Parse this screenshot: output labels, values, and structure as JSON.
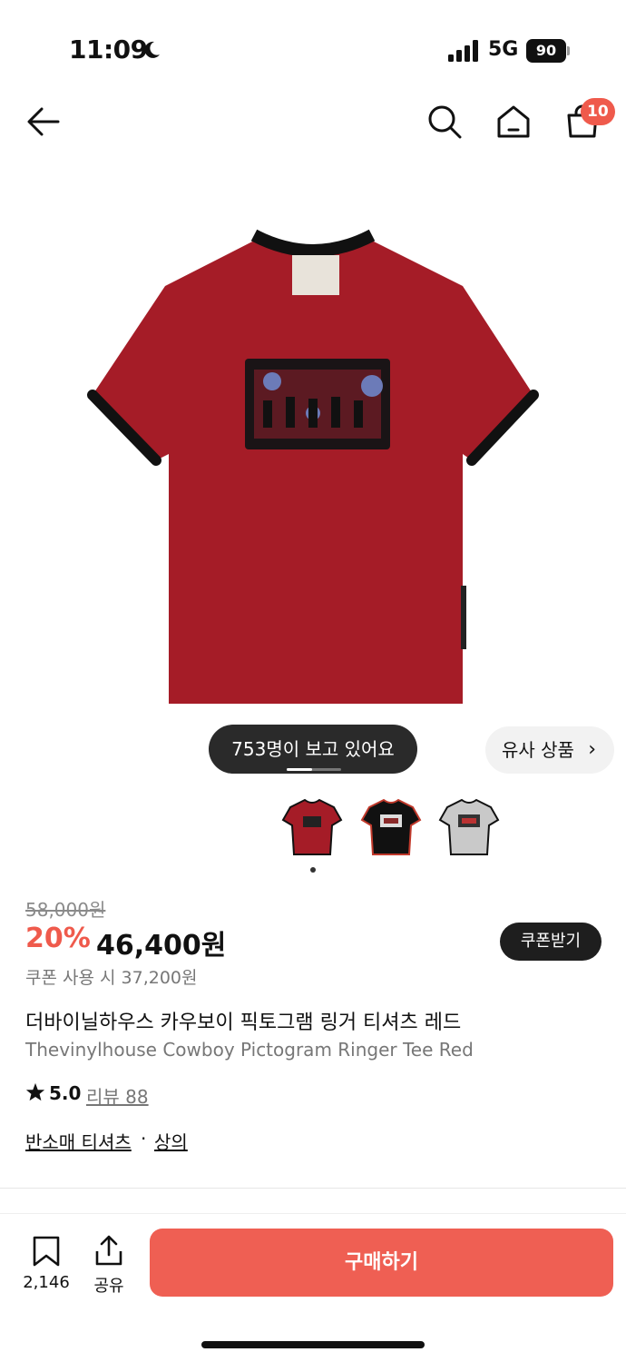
{
  "status": {
    "time": "11:09",
    "network": "5G",
    "battery": "90"
  },
  "header": {
    "cart_count": "10",
    "icons": [
      "back-arrow-icon",
      "search-icon",
      "home-icon",
      "cart-icon"
    ]
  },
  "gallery": {
    "viewers_text": "753명이 보고 있어요",
    "similar_label": "유사 상품",
    "thumbnails": [
      "red",
      "black",
      "gray"
    ]
  },
  "product": {
    "original_price": "58,000원",
    "discount": "20%",
    "price": "46,400원",
    "coupon_button": "쿠폰받기",
    "coupon_price": "쿠폰 사용 시 37,200원",
    "title_ko": "더바이닐하우스 카우보이 픽토그램 링거 티셔츠 레드",
    "title_en": "Thevinylhouse Cowboy Pictogram Ringer Tee Red",
    "rating": "5.0",
    "review_label": "리뷰 88",
    "category_1": "반소매 티셔츠",
    "category_sep": "·",
    "category_2": "상의"
  },
  "bottom": {
    "bookmark_count": "2,146",
    "share_label": "공유",
    "buy_label": "구매하기"
  },
  "colors": {
    "accent": "#ef5a4c",
    "shirt_red": "#a51c27",
    "dark": "#1e1e1e"
  }
}
